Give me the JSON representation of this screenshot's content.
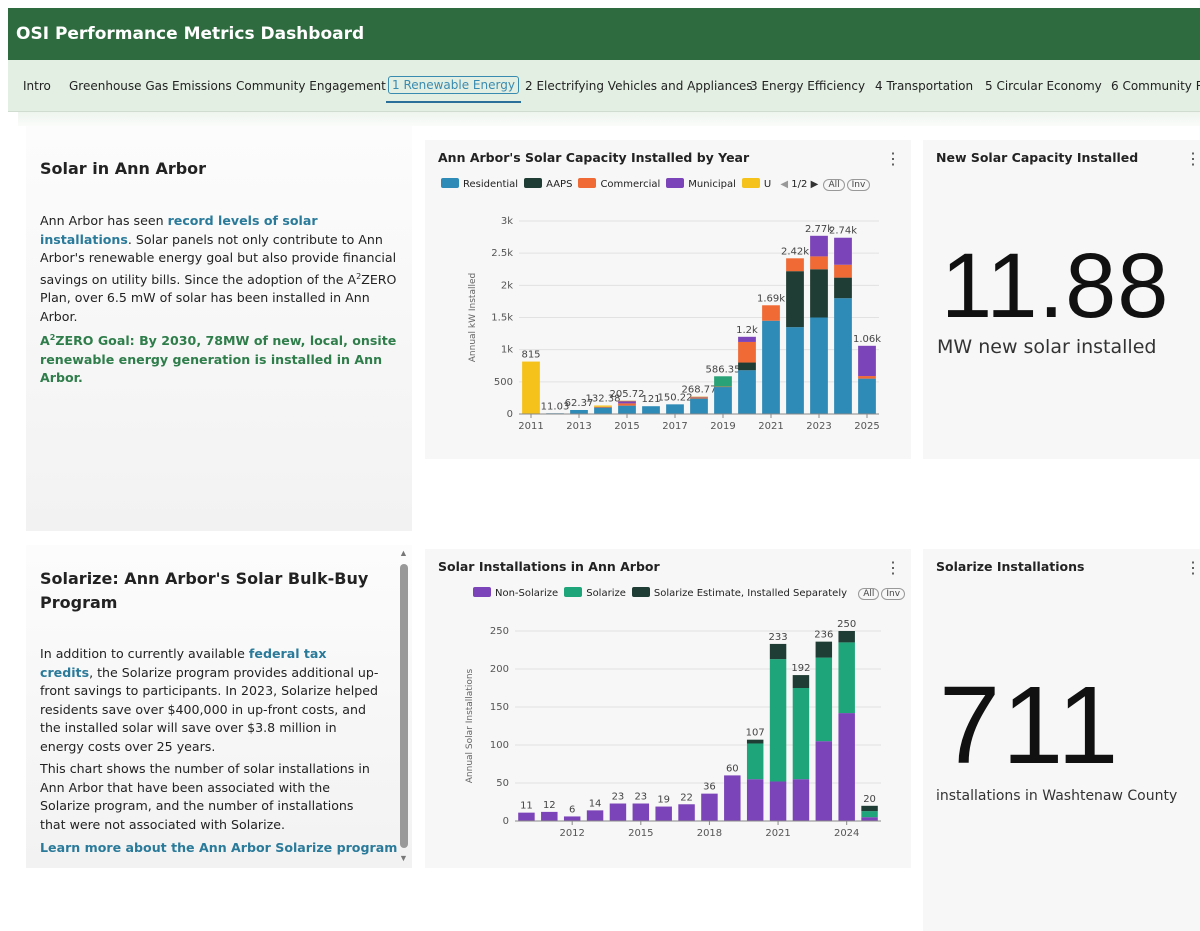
{
  "header": {
    "title": "OSI Performance Metrics Dashboard"
  },
  "tabs": [
    "Intro",
    "Greenhouse Gas Emissions",
    "Community Engagement",
    "1 Renewable Energy",
    "2 Electrifying Vehicles and Appliances",
    "3 Energy Efficiency",
    "4 Transportation",
    "5 Circular Economy",
    "6 Community R"
  ],
  "active_tab": "1 Renewable Energy",
  "solar_card": {
    "title": "Solar in Ann Arbor",
    "p1_a": "Ann Arbor has seen ",
    "p1_link": "record levels of solar installations",
    "p1_b": ". Solar panels not only contribute to Ann Arbor's renewable energy goal but also provide financial savings on utility bills. Since the adoption of the A",
    "p1_sup": "2",
    "p1_c": "ZERO Plan, over 6.5 mW of solar has been installed in Ann Arbor.",
    "goal_a": "A",
    "goal_sup": "2",
    "goal_b": "ZERO Goal: By 2030, 78MW of new, local, onsite renewable energy generation is installed in Ann Arbor."
  },
  "solarize_card": {
    "title": "Solarize: Ann Arbor's Solar Bulk-Buy Program",
    "p1_a": "In addition to currently available ",
    "p1_link": "federal tax credits",
    "p1_b": ", the Solarize program provides additional up-front savings to participants. In 2023, Solarize helped residents save over $400,000 in up-front costs, and the installed solar will save over $3.8 million in energy costs over 25 years.",
    "p2": "This chart shows the number of solar installations in Ann Arbor that have been associated with the Solarize program, and the number of installations that were not associated with Solarize.",
    "link": "Learn more about the Ann Arbor Solarize program"
  },
  "kpi_capacity": {
    "title": "New Solar Capacity Installed",
    "value": "11.88",
    "label": "MW new solar installed"
  },
  "kpi_installs": {
    "title": "Solarize Installations",
    "value": "711",
    "label": "installations in Washtenaw County"
  },
  "legend_controls": {
    "all": "All",
    "inv": "Inv",
    "page": "1/2"
  },
  "chart_data": [
    {
      "type": "bar",
      "stacked": true,
      "title": "Ann Arbor's Solar Capacity Installed by Year",
      "ylabel": "Annual kW Installed",
      "ylim": [
        0,
        3000
      ],
      "yticks": [
        "0",
        "500",
        "1k",
        "1.5k",
        "2k",
        "2.5k",
        "3k"
      ],
      "xticks": [
        "2011",
        "2013",
        "2015",
        "2017",
        "2019",
        "2021",
        "2023",
        "2025"
      ],
      "legend_visible": [
        "Residential",
        "AAPS",
        "Commercial",
        "Municipal",
        "U"
      ],
      "categories": [
        "2011",
        "2012",
        "2013",
        "2014",
        "2015",
        "2016",
        "2017",
        "2018",
        "2019",
        "2020",
        "2021",
        "2022",
        "2023",
        "2024",
        "2025"
      ],
      "series": [
        {
          "name": "Residential",
          "color": "#2e8bb8",
          "values": [
            0,
            11.03,
            62.37,
            100,
            130,
            121,
            150.22,
            240,
            420,
            680,
            1450,
            1350,
            1500,
            1800,
            550
          ]
        },
        {
          "name": "AAPS",
          "color": "#1f3d34",
          "values": [
            0,
            0,
            0,
            0,
            0,
            0,
            0,
            0,
            0,
            120,
            0,
            870,
            750,
            320,
            0
          ]
        },
        {
          "name": "Commercial",
          "color": "#ef6a35",
          "values": [
            0,
            0,
            0,
            12,
            35,
            0,
            0,
            15,
            6,
            320,
            240,
            200,
            200,
            200,
            40
          ]
        },
        {
          "name": "Municipal",
          "color": "#7b44b8",
          "values": [
            0,
            0,
            0,
            0,
            40,
            0,
            0,
            13,
            0,
            80,
            0,
            0,
            320,
            420,
            470
          ]
        },
        {
          "name": "U",
          "color": "#f5c21b",
          "values": [
            815,
            0,
            0,
            20.38,
            0.72,
            0,
            0,
            0.77,
            0,
            0,
            0,
            0,
            0,
            0,
            0
          ]
        },
        {
          "name": "",
          "color": "#2aa277",
          "values": [
            0,
            0,
            0,
            0,
            0,
            0,
            0,
            0,
            160.35,
            0,
            0,
            0,
            0,
            0,
            0
          ]
        }
      ],
      "totals": [
        "815",
        "11.03",
        "62.37",
        "132.38",
        "205.72",
        "121",
        "150.22",
        "268.77",
        "586.35",
        "1.2k",
        "1.69k",
        "2.42k",
        "2.77k",
        "2.74k",
        "1.06k"
      ]
    },
    {
      "type": "bar",
      "stacked": true,
      "title": "Solar Installations in Ann Arbor",
      "ylabel": "Annual Solar Installations",
      "ylim": [
        0,
        250
      ],
      "yticks": [
        "0",
        "50",
        "100",
        "150",
        "200",
        "250"
      ],
      "xticks": [
        "2012",
        "2015",
        "2018",
        "2021",
        "2024"
      ],
      "categories": [
        "2010",
        "2011",
        "2012",
        "2013",
        "2014",
        "2015",
        "2016",
        "2017",
        "2018",
        "2019",
        "2020",
        "2021",
        "2022",
        "2023",
        "2024",
        "2025"
      ],
      "series": [
        {
          "name": "Non-Solarize",
          "color": "#7b44b8",
          "values": [
            11,
            12,
            6,
            14,
            23,
            23,
            19,
            22,
            36,
            60,
            55,
            52,
            55,
            105,
            142,
            5
          ]
        },
        {
          "name": "Solarize",
          "color": "#1fa57a",
          "values": [
            0,
            0,
            0,
            0,
            0,
            0,
            0,
            0,
            0,
            0,
            47,
            161,
            120,
            110,
            93,
            8
          ]
        },
        {
          "name": "Solarize Estimate, Installed Separately",
          "color": "#1f3d34",
          "values": [
            0,
            0,
            0,
            0,
            0,
            0,
            0,
            0,
            0,
            0,
            5,
            20,
            17,
            21,
            15,
            7
          ]
        }
      ],
      "totals": [
        "11",
        "12",
        "6",
        "14",
        "23",
        "23",
        "19",
        "22",
        "36",
        "60",
        "107",
        "233",
        "192",
        "236",
        "250",
        "20"
      ]
    }
  ]
}
